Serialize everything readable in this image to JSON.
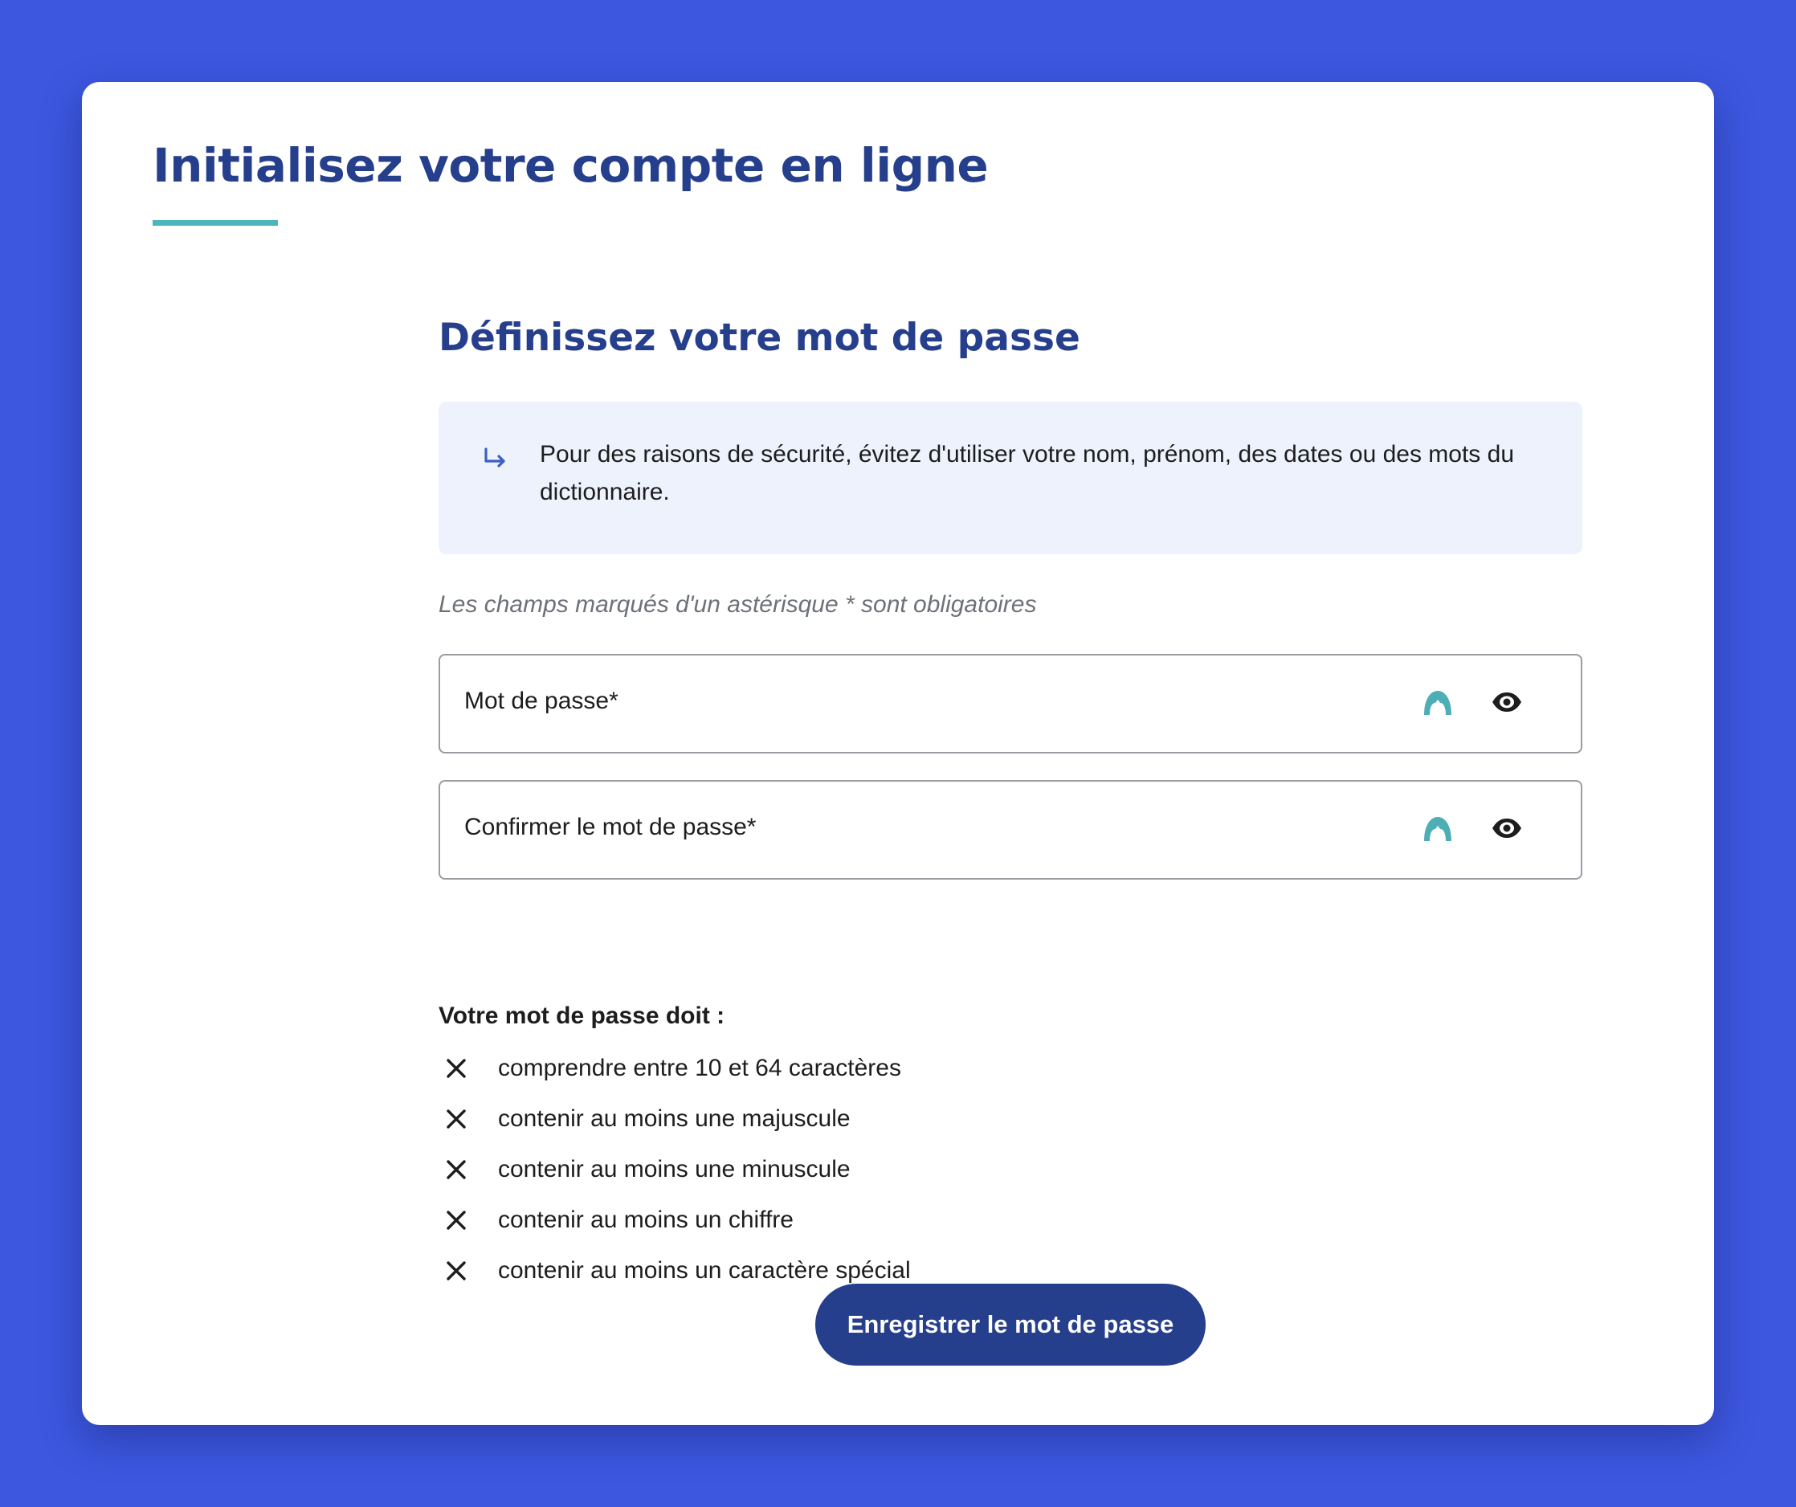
{
  "page": {
    "title": "Initialisez votre compte en ligne"
  },
  "form": {
    "section_title": "Définissez votre mot de passe",
    "info": {
      "icon": "arrow-return-right-icon",
      "text": "Pour des raisons de sécurité, évitez d'utiliser votre nom, prénom, des dates ou des mots du dictionnaire."
    },
    "required_note": "Les champs marqués d'un astérisque * sont obligatoires",
    "fields": [
      {
        "label": "Mot de passe*",
        "value": "",
        "icons": [
          "password-manager-icon",
          "eye-icon"
        ]
      },
      {
        "label": "Confirmer le mot de passe*",
        "value": "",
        "icons": [
          "password-manager-icon",
          "eye-icon"
        ]
      }
    ],
    "rules_title": "Votre mot de passe doit :",
    "rules": [
      {
        "text": "comprendre entre 10 et 64 caractères",
        "status": "unmet",
        "icon": "cross-icon"
      },
      {
        "text": "contenir au moins une majuscule",
        "status": "unmet",
        "icon": "cross-icon"
      },
      {
        "text": "contenir au moins une minuscule",
        "status": "unmet",
        "icon": "cross-icon"
      },
      {
        "text": "contenir au moins un chiffre",
        "status": "unmet",
        "icon": "cross-icon"
      },
      {
        "text": "contenir au moins un caractère spécial",
        "status": "unmet",
        "icon": "cross-icon"
      }
    ],
    "submit_label": "Enregistrer le mot de passe"
  },
  "colors": {
    "background": "#3d57df",
    "primary": "#263f8c",
    "accent": "#4bb5be",
    "info_background": "#eef2fd"
  }
}
